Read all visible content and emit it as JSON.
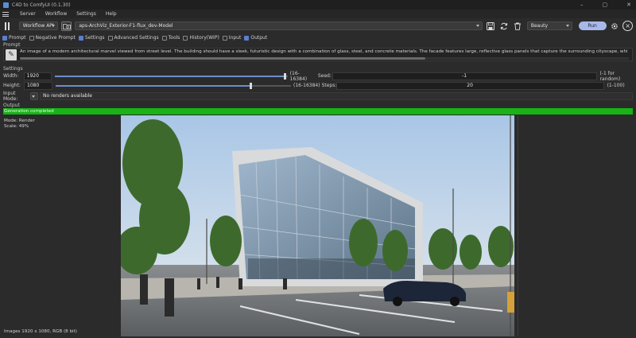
{
  "window": {
    "title": "C4D to ComfyUI (0.1.30)",
    "controls": [
      "–",
      "▢",
      "✕"
    ]
  },
  "menu": {
    "items": [
      "Server",
      "Workflow",
      "Settings",
      "Help"
    ]
  },
  "toolbar": {
    "api_mode": "Workflow API",
    "workflow_file": "aps-ArchViz_Exterior-F1-flux_dev-Model",
    "preset": "Beauty",
    "run_label": "Run"
  },
  "panels": [
    {
      "label": "Prompt",
      "checked": true
    },
    {
      "label": "Negative Prompt",
      "checked": false
    },
    {
      "label": "Settings",
      "checked": true
    },
    {
      "label": "Advanced Settings",
      "checked": false
    },
    {
      "label": "Tools",
      "checked": false
    },
    {
      "label": "History(WIP)",
      "checked": false
    },
    {
      "label": "Input",
      "checked": false
    },
    {
      "label": "Output",
      "checked": true
    }
  ],
  "prompt": {
    "section_label": "Prompt",
    "text": "An image of a modern architectural marvel viewed from street level. The building should have a sleek, futuristic design with a combination of glass, steel, and concrete materials. The facade features large, reflective glass panels that capture the surrounding cityscape, while the structure itself has sharp, a"
  },
  "settings": {
    "section_label": "Settings",
    "width": {
      "label": "Width:",
      "value": "1920",
      "range": "(16-16384)",
      "fraction": 0.99
    },
    "height": {
      "label": "Height:",
      "value": "1080",
      "range": "(16-16384)",
      "fraction": 0.83
    },
    "seed": {
      "label": "Seed:",
      "value": "-1",
      "hint": "(-1 for random)"
    },
    "steps": {
      "label": "Steps:",
      "value": "20",
      "hint": "(1-100)"
    }
  },
  "input_mode": {
    "label": "Input Mode:",
    "value": "No renders available"
  },
  "output": {
    "section_label": "Output",
    "status": "Generation completed",
    "progress": 1.0,
    "mode": "Mode: Render",
    "scale": "Scale: 49%",
    "image_info": "Images 1920 x 1080, RGB (8 bit)"
  },
  "colors": {
    "accent": "#a9b8ea",
    "progress": "#17b317",
    "checkbox_on": "#5a7fd0"
  }
}
